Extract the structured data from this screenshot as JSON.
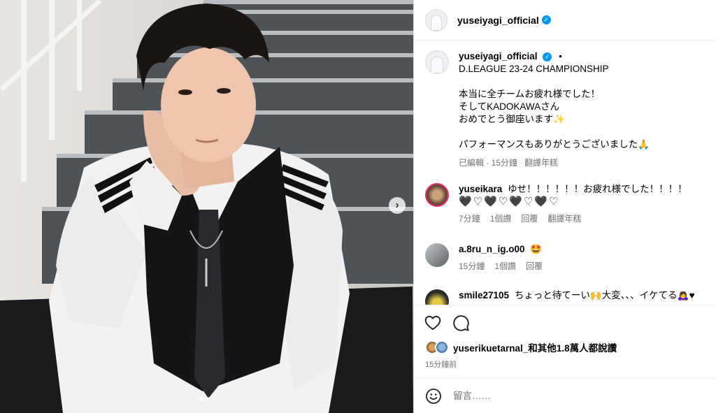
{
  "header": {
    "username": "yuseiyagi_official"
  },
  "caption": {
    "username": "yuseiyagi_official",
    "dot": "•",
    "lines": [
      "D.LEAGUE 23-24 CHAMPIONSHIP",
      "",
      "本当に全チームお疲れ様でした！",
      "そしてKADOKAWAさん",
      "おめでとう御座います✨",
      "",
      "パフォーマンスもありがとうございました🙏"
    ],
    "edited": "已編輯 · 15分鐘",
    "translate": "翻譯年糕"
  },
  "comments": [
    {
      "username": "yuseikara",
      "text": "ゆせ！！！！！！お疲れ様でした！！！！",
      "sub": "🖤♡🖤♡🖤♡🖤♡",
      "time": "7分鐘",
      "likes": "1個讚",
      "reply": "回覆",
      "translate": "翻譯年糕"
    },
    {
      "username": "a.8ru_n_ig.o00",
      "text": "🤩",
      "time": "15分鐘",
      "likes": "1個讚",
      "reply": "回覆"
    },
    {
      "username": "smile27105",
      "text": "ちょっと待てーい🙌大変、、、イケてる🙇‍♀️♥"
    }
  ],
  "likes": {
    "text": "yuserikuetarnal_和其他1.8萬人都說讚"
  },
  "timestamp": "15分鐘前",
  "add_comment": {
    "placeholder": "留言……"
  },
  "colors": {
    "verified": "#0095f6",
    "muted": "#737373",
    "border": "#dbdbdb"
  },
  "icons": {
    "like": "heart-outline",
    "comment": "speech-bubble",
    "emoji": "smiley",
    "next": "chevron-right"
  }
}
